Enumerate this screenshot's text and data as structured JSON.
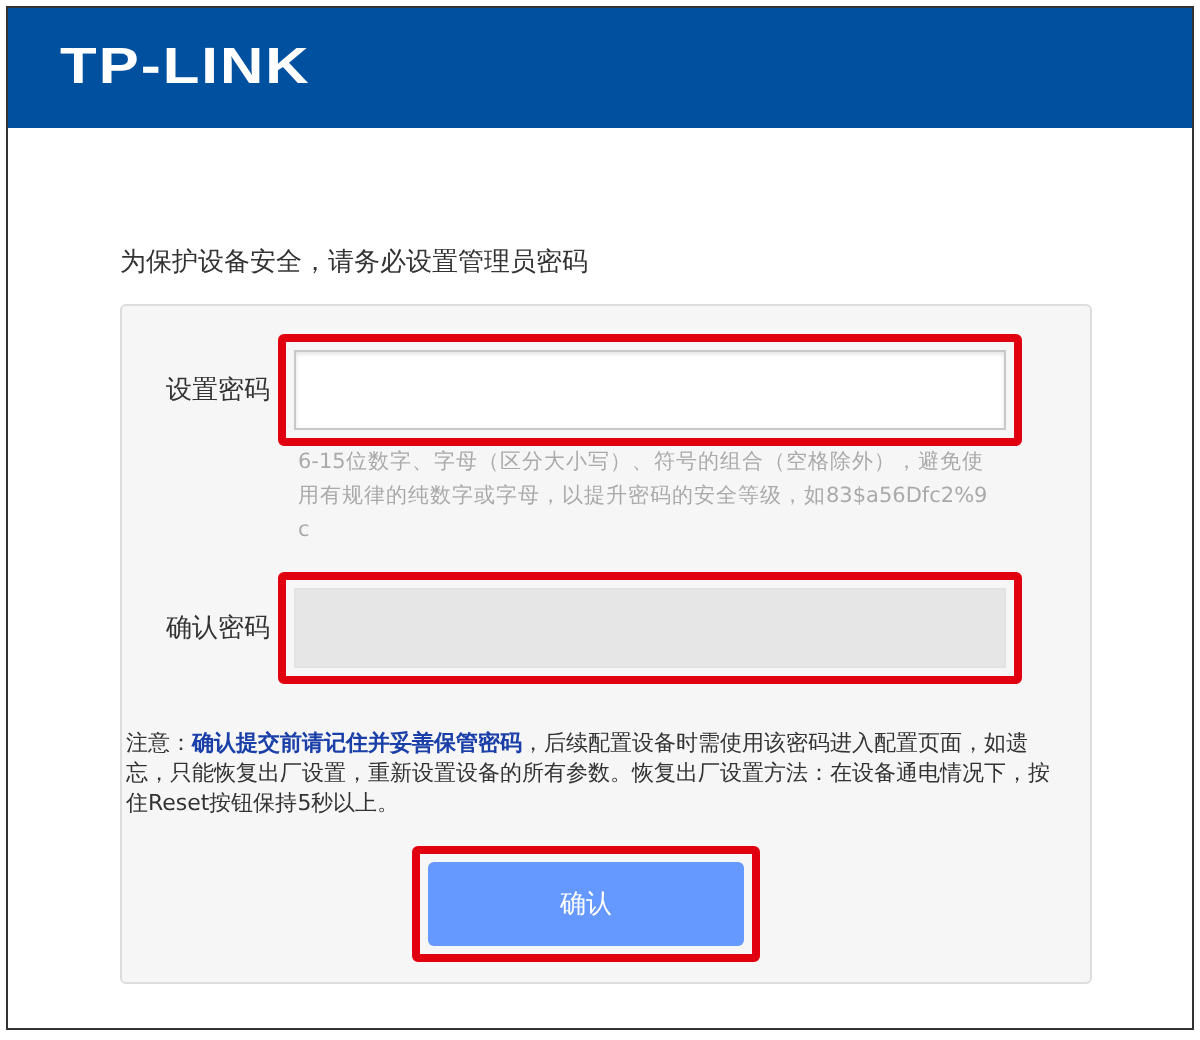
{
  "header": {
    "logo": "TP-LINK"
  },
  "intro": "为保护设备安全，请务必设置管理员密码",
  "fields": [
    {
      "label": "设置密码",
      "disabled": false,
      "highlighted": true,
      "hint": "6-15位数字、字母（区分大小写）、符号的组合（空格除外），避免使用有规律的纯数字或字母，以提升密码的安全等级，如83$a56Dfc2%9c"
    },
    {
      "label": "确认密码",
      "disabled": true,
      "highlighted": true
    }
  ],
  "note": "注意：**确认提交前请记住并妥善保管密码**，后续配置设备时需使用该密码进入配置页面，如遗忘，只能恢复出厂设置，重新设置设备的所有参数。恢复出厂设置方法：在设备通电情况下，按住Reset按钮保持5秒以上。",
  "button": {
    "label": "确认",
    "highlighted": true
  }
}
